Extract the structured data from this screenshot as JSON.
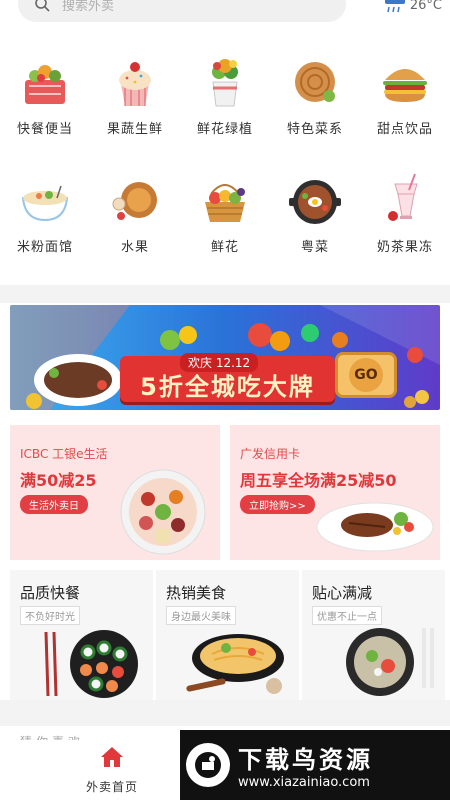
{
  "search": {
    "placeholder": "搜索外卖"
  },
  "weather": {
    "temperature": "26°C",
    "icon": "cloud-rain-icon"
  },
  "categories": [
    {
      "label": "快餐便当",
      "icon": "fast-food-bento-icon"
    },
    {
      "label": "果蔬生鲜",
      "icon": "cupcake-icon"
    },
    {
      "label": "鲜花绿植",
      "icon": "flower-pot-icon"
    },
    {
      "label": "特色菜系",
      "icon": "pancake-icon"
    },
    {
      "label": "甜点饮品",
      "icon": "burger-icon"
    },
    {
      "label": "米粉面馆",
      "icon": "noodle-bowl-icon"
    },
    {
      "label": "水果",
      "icon": "fruit-plate-icon"
    },
    {
      "label": "鲜花",
      "icon": "fruit-basket-icon"
    },
    {
      "label": "粤菜",
      "icon": "stone-pot-icon"
    },
    {
      "label": "奶茶果冻",
      "icon": "milk-tea-icon"
    }
  ],
  "banner": {
    "small": "欢庆 12.12",
    "main": "5折全城吃大牌",
    "button": "GO"
  },
  "promos": [
    {
      "title": "ICBC 工银e生活",
      "headline": "满50减25",
      "pill": "生活外卖日"
    },
    {
      "title": "广发信用卡",
      "headline": "周五享全场满25减50",
      "pill": "立即抢购>>"
    }
  ],
  "features": [
    {
      "title": "品质快餐",
      "subtitle": "不负好时光"
    },
    {
      "title": "热销美食",
      "subtitle": "身边最火美味"
    },
    {
      "title": "贴心满减",
      "subtitle": "优惠不止一点"
    }
  ],
  "section_partial": "猜你喜欢",
  "nav": {
    "home_label": "外卖首页",
    "home_color": "#e0383b"
  },
  "watermark": {
    "text": "下载鸟资源",
    "url": "www.xiazainiao.com"
  }
}
